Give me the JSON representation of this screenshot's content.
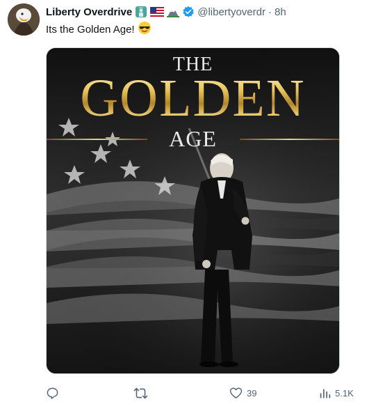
{
  "tweet": {
    "display_name": "Liberty Overdrive",
    "handle": "@libertyoverdr",
    "separator": "·",
    "time": "8h",
    "text": "Its the Golden Age!",
    "avatar_icon": "eagle-avatar-icon",
    "name_emojis": [
      "statue-of-liberty-icon",
      "us-flag-icon",
      "mountain-icon",
      "verified-badge-icon"
    ],
    "text_emoji": "sunglasses-emoji-icon"
  },
  "media": {
    "line1": "THE",
    "line2": "GOLDEN",
    "line3": "AGE"
  },
  "actions": {
    "reply_count": "",
    "retweet_count": "",
    "like_count": "39",
    "views_count": "5.1K"
  },
  "colors": {
    "verified": "#1d9bf0",
    "secondary_text": "#536471",
    "gold": "#d8b24a"
  }
}
